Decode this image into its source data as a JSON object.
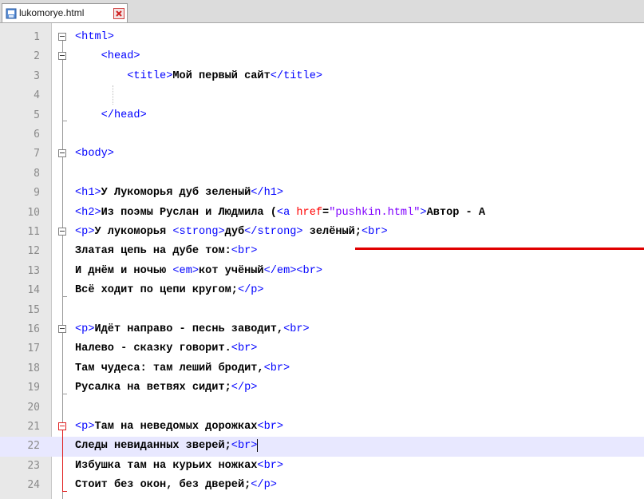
{
  "tab": {
    "label": "lukomorye.html"
  },
  "colors": {
    "tag": "#0000ff",
    "attr": "#ff0000",
    "string": "#8000ff",
    "text": "#000000",
    "underline": "#e00000",
    "current_line": "#e8e8ff"
  },
  "lines": [
    {
      "n": "1",
      "code": [
        {
          "t": "tag",
          "s": "<html>"
        }
      ]
    },
    {
      "n": "2",
      "code": [
        {
          "t": "txt",
          "s": "    "
        },
        {
          "t": "tag",
          "s": "<head>"
        }
      ]
    },
    {
      "n": "3",
      "code": [
        {
          "t": "txt",
          "s": "        "
        },
        {
          "t": "tag",
          "s": "<title>"
        },
        {
          "t": "txt",
          "s": "Мой первый сайт"
        },
        {
          "t": "tag",
          "s": "</title>"
        }
      ]
    },
    {
      "n": "4",
      "code": []
    },
    {
      "n": "5",
      "code": [
        {
          "t": "txt",
          "s": "    "
        },
        {
          "t": "tag",
          "s": "</head>"
        }
      ]
    },
    {
      "n": "6",
      "code": []
    },
    {
      "n": "7",
      "code": [
        {
          "t": "tag",
          "s": "<body>"
        }
      ]
    },
    {
      "n": "8",
      "code": []
    },
    {
      "n": "9",
      "code": [
        {
          "t": "tag",
          "s": "<h1>"
        },
        {
          "t": "txt",
          "s": "У Лукоморья дуб зеленый"
        },
        {
          "t": "tag",
          "s": "</h1>"
        }
      ]
    },
    {
      "n": "10",
      "code": [
        {
          "t": "tag",
          "s": "<h2>"
        },
        {
          "t": "txt",
          "s": "Из поэмы Руслан и Людмила ("
        },
        {
          "t": "tag",
          "s": "<a "
        },
        {
          "t": "attr",
          "s": "href"
        },
        {
          "t": "txt",
          "s": "="
        },
        {
          "t": "str",
          "s": "\"pushkin.html\""
        },
        {
          "t": "tag",
          "s": ">"
        },
        {
          "t": "txt",
          "s": "Автор - А"
        }
      ]
    },
    {
      "n": "11",
      "code": [
        {
          "t": "tag",
          "s": "<p>"
        },
        {
          "t": "txt",
          "s": "У лукоморья "
        },
        {
          "t": "tag",
          "s": "<strong>"
        },
        {
          "t": "txt",
          "s": "дуб"
        },
        {
          "t": "tag",
          "s": "</strong>"
        },
        {
          "t": "txt",
          "s": " зелёный;"
        },
        {
          "t": "tag",
          "s": "<br>"
        }
      ]
    },
    {
      "n": "12",
      "code": [
        {
          "t": "txt",
          "s": "Златая цепь на дубе том:"
        },
        {
          "t": "tag",
          "s": "<br>"
        }
      ]
    },
    {
      "n": "13",
      "code": [
        {
          "t": "txt",
          "s": "И днём и ночью "
        },
        {
          "t": "tag",
          "s": "<em>"
        },
        {
          "t": "txt",
          "s": "кот учёный"
        },
        {
          "t": "tag",
          "s": "</em><br>"
        }
      ]
    },
    {
      "n": "14",
      "code": [
        {
          "t": "txt",
          "s": "Всё ходит по цепи кругом;"
        },
        {
          "t": "tag",
          "s": "</p>"
        }
      ]
    },
    {
      "n": "15",
      "code": []
    },
    {
      "n": "16",
      "code": [
        {
          "t": "tag",
          "s": "<p>"
        },
        {
          "t": "txt",
          "s": "Идёт направо - песнь заводит,"
        },
        {
          "t": "tag",
          "s": "<br>"
        }
      ]
    },
    {
      "n": "17",
      "code": [
        {
          "t": "txt",
          "s": "Налево - сказку говорит."
        },
        {
          "t": "tag",
          "s": "<br>"
        }
      ]
    },
    {
      "n": "18",
      "code": [
        {
          "t": "txt",
          "s": "Там чудеса: там леший бродит,"
        },
        {
          "t": "tag",
          "s": "<br>"
        }
      ]
    },
    {
      "n": "19",
      "code": [
        {
          "t": "txt",
          "s": "Русалка на ветвях сидит;"
        },
        {
          "t": "tag",
          "s": "</p>"
        }
      ]
    },
    {
      "n": "20",
      "code": []
    },
    {
      "n": "21",
      "code": [
        {
          "t": "tag",
          "s": "<p>"
        },
        {
          "t": "txt",
          "s": "Там на неведомых дорожках"
        },
        {
          "t": "tag",
          "s": "<br>"
        }
      ]
    },
    {
      "n": "22",
      "code": [
        {
          "t": "txt",
          "s": "Следы невиданных зверей;"
        },
        {
          "t": "tag",
          "s": "<br>"
        }
      ],
      "current": true
    },
    {
      "n": "23",
      "code": [
        {
          "t": "txt",
          "s": "Избушка там на курьих ножках"
        },
        {
          "t": "tag",
          "s": "<br>"
        }
      ]
    },
    {
      "n": "24",
      "code": [
        {
          "t": "txt",
          "s": "Стоит без окон, без дверей;"
        },
        {
          "t": "tag",
          "s": "</p>"
        }
      ]
    }
  ]
}
